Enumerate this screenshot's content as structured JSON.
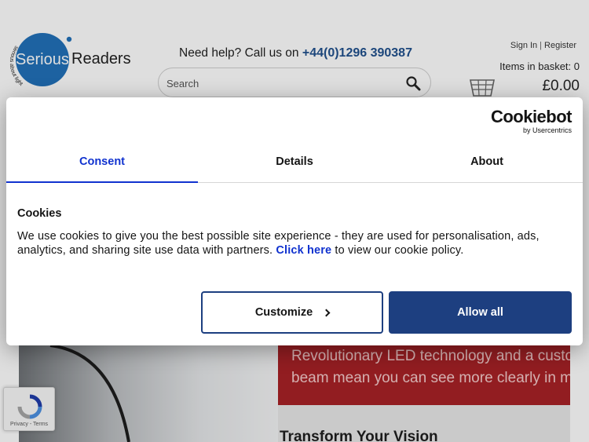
{
  "header": {
    "logo_word_serious": "Serious",
    "logo_word_readers": "Readers",
    "logo_tagline": "serious about light",
    "help_prefix": "Need help? Call us on",
    "help_phone": "+44(0)1296 390387",
    "search_placeholder": "Search",
    "sign_in": "Sign In",
    "separator": "|",
    "register": "Register",
    "basket_count": "Items in basket: 0",
    "basket_total": "£0.00"
  },
  "hero": {
    "banner_text_1": "Revolutionary LED technology and a custo",
    "banner_text_2": "beam mean you can see more clearly in m",
    "subheading": "Transform Your Vision"
  },
  "recaptcha": {
    "terms": "Privacy - Terms"
  },
  "cookie_dialog": {
    "brand_main": "Cookiebot",
    "brand_sub": "by Usercentrics",
    "tabs": [
      {
        "label": "Consent",
        "active": true
      },
      {
        "label": "Details",
        "active": false
      },
      {
        "label": "About",
        "active": false
      }
    ],
    "title": "Cookies",
    "text_before_link": "We use cookies to give you the best possible site experience - they are used for personalisation, ads, analytics, and sharing site use data with partners.",
    "link_text": "Click here",
    "text_after_link": "to view our cookie policy.",
    "customize_label": "Customize",
    "allow_all_label": "Allow all"
  },
  "colors": {
    "brand_blue": "#1d3f80",
    "tab_active": "#1032cf",
    "banner_red": "#a71f23"
  },
  "icons": {
    "search": "magnifier-icon",
    "basket": "basket-icon",
    "customize_chevron": "chevron-right-icon",
    "recaptcha": "recaptcha-icon"
  }
}
